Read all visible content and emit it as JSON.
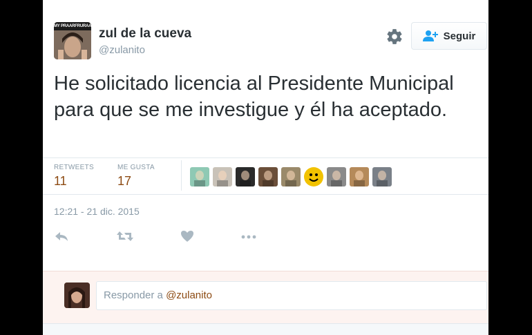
{
  "author": {
    "name": "zul de la cueva",
    "handle": "@zulanito",
    "avatar_banner": "MY PRAARFRURAAAA"
  },
  "follow_button": {
    "label": "Seguir",
    "icon": "add-user-icon"
  },
  "settings_icon": "gear-icon",
  "tweet": {
    "text": "He solicitado licencia al Presidente Municipal para que se me investigue y él ha aceptado."
  },
  "stats": {
    "retweets_label": "RETWEETS",
    "retweets_value": "11",
    "likes_label": "ME GUSTA",
    "likes_value": "17"
  },
  "liker_avatars": [
    "#8fc9b4",
    "#c9c2b8",
    "#2a2a2a",
    "#6b4f3a",
    "#9a8a6a",
    "#f2c200",
    "#8a8a8a",
    "#b58a5a",
    "#7a8088"
  ],
  "timestamp": "12:21 - 21 dic. 2015",
  "actions": [
    "reply-icon",
    "retweet-icon",
    "heart-icon",
    "more-icon"
  ],
  "reply": {
    "prefix": "Responder a ",
    "mention": "@zulanito"
  },
  "colors": {
    "text": "#292f33",
    "muted": "#8899a6",
    "accent": "#8c4a12",
    "reply_bg": "#fdf3f0"
  }
}
